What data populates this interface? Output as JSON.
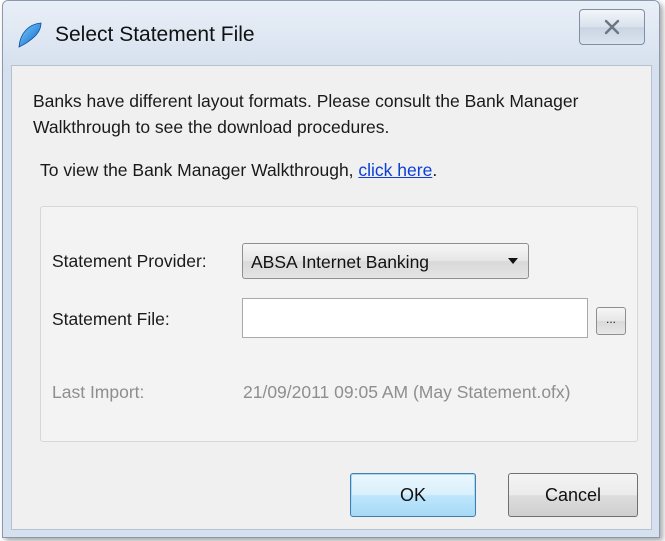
{
  "window": {
    "title": "Select Statement File",
    "close_glyph": "X"
  },
  "intro": {
    "text": "Banks have different layout formats.  Please consult the Bank Manager Walkthrough to see the download procedures.",
    "walkthrough_prefix": "To view the Bank Manager Walkthrough, ",
    "walkthrough_link": "click here",
    "walkthrough_suffix": "."
  },
  "form": {
    "provider_label": "Statement Provider:",
    "provider_value": "ABSA Internet Banking",
    "file_label": "Statement File:",
    "file_value": "",
    "browse_label": "...",
    "last_import_label": "Last Import:",
    "last_import_value": "21/09/2011 09:05 AM (May Statement.ofx)"
  },
  "buttons": {
    "ok": "OK",
    "cancel": "Cancel"
  },
  "icons": {
    "app": "app-logo-icon",
    "close": "close-icon",
    "dropdown": "chevron-down-icon"
  }
}
